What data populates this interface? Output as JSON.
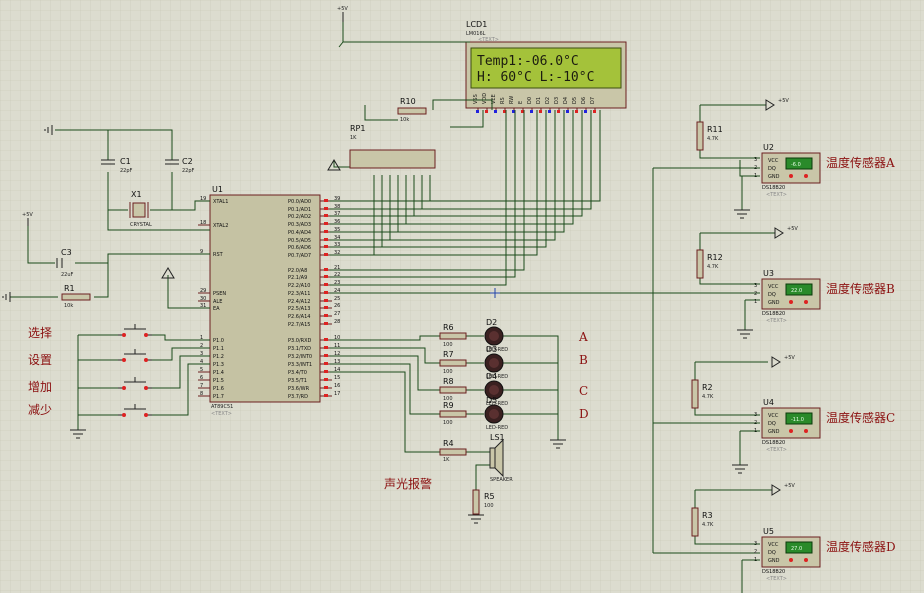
{
  "title": "",
  "lcd": {
    "ref": "LCD1",
    "part": "LM016L",
    "line1": "Temp1:-06.0°C",
    "line2": "H: 60°C  L:-10°C",
    "pins": [
      "VSS",
      "VDD",
      "VEE",
      "RS",
      "RW",
      "E",
      "D0",
      "D1",
      "D2",
      "D3",
      "D4",
      "D5",
      "D6",
      "D7"
    ]
  },
  "mcu": {
    "ref": "U1",
    "part": "AT89C51",
    "left_pins": [
      "XTAL1",
      "XTAL2",
      "RST",
      "PSEN",
      "ALE",
      "EA",
      "P1.0",
      "P1.1",
      "P1.2",
      "P1.3",
      "P1.4",
      "P1.5",
      "P1.6",
      "P1.7"
    ],
    "left_nums": [
      "19",
      "18",
      "9",
      "29",
      "30",
      "31",
      "1",
      "2",
      "3",
      "4",
      "5",
      "6",
      "7",
      "8"
    ],
    "right_pins": [
      "P0.0/AD0",
      "P0.1/AD1",
      "P0.2/AD2",
      "P0.3/AD3",
      "P0.4/AD4",
      "P0.5/AD5",
      "P0.6/AD6",
      "P0.7/AD7",
      "P2.0/A8",
      "P2.1/A9",
      "P2.2/A10",
      "P2.3/A11",
      "P2.4/A12",
      "P2.5/A13",
      "P2.6/A14",
      "P2.7/A15",
      "P3.0/RXD",
      "P3.1/TXD",
      "P3.2/INT0",
      "P3.3/INT1",
      "P3.4/T0",
      "P3.5/T1",
      "P3.6/WR",
      "P3.7/RD"
    ],
    "right_nums": [
      "39",
      "38",
      "37",
      "36",
      "35",
      "34",
      "33",
      "32",
      "21",
      "22",
      "23",
      "24",
      "25",
      "26",
      "27",
      "28",
      "10",
      "11",
      "12",
      "13",
      "14",
      "15",
      "16",
      "17"
    ]
  },
  "placeholder": "<TEXT>",
  "components": {
    "c1": {
      "ref": "C1",
      "value": "22pF"
    },
    "c2": {
      "ref": "C2",
      "value": "22pF"
    },
    "c3": {
      "ref": "C3",
      "value": "22uF"
    },
    "x1": {
      "ref": "X1",
      "value": "CRYSTAL"
    },
    "r1": {
      "ref": "R1",
      "value": "10k"
    },
    "r10": {
      "ref": "R10",
      "value": "10k"
    },
    "rp1": {
      "ref": "RP1",
      "value": "1K"
    },
    "r6": {
      "ref": "R6",
      "value": "100"
    },
    "r7": {
      "ref": "R7",
      "value": "100"
    },
    "r8": {
      "ref": "R8",
      "value": "100"
    },
    "r9": {
      "ref": "R9",
      "value": "100"
    },
    "r4": {
      "ref": "R4",
      "value": "1K"
    },
    "r5": {
      "ref": "R5",
      "value": "100"
    },
    "ls1": {
      "ref": "LS1",
      "value": "SPEAKER"
    },
    "power": "+5V",
    "led_part": "LED-RED",
    "leds": [
      "D2",
      "D3",
      "D4",
      "D5"
    ]
  },
  "buttons": [
    "选择",
    "设置",
    "增加",
    "减少"
  ],
  "alarm_label": "声光报警",
  "led_labels": [
    "A",
    "B",
    "C",
    "D"
  ],
  "sensors": [
    {
      "ref": "U2",
      "rref": "R11",
      "rval": "4.7K",
      "reading": "-6.0",
      "label": "温度传感器A",
      "part": "DS18B20"
    },
    {
      "ref": "U3",
      "rref": "R12",
      "rval": "4.7K",
      "reading": "22.0",
      "label": "温度传感器B",
      "part": "DS18B20"
    },
    {
      "ref": "U4",
      "rref": "R2",
      "rval": "4.7K",
      "reading": "-11.0",
      "label": "温度传感器C",
      "part": "DS18B20"
    },
    {
      "ref": "U5",
      "rref": "R3",
      "rval": "4.7K",
      "reading": "27.0",
      "label": "温度传感器D",
      "part": "DS18B20"
    }
  ],
  "sensor_pins": [
    "VCC",
    "DQ",
    "GND"
  ]
}
